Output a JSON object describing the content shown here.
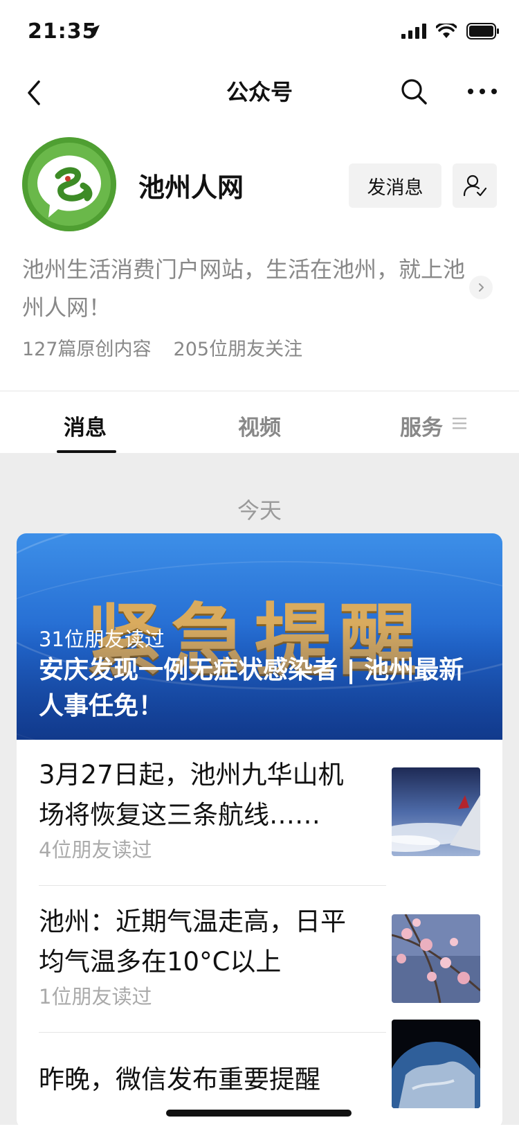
{
  "status_bar": {
    "time": "21:35"
  },
  "nav": {
    "title": "公众号"
  },
  "profile": {
    "name": "池州人网",
    "message_button": "发消息",
    "description": "池州生活消费门户网站，生活在池州，就上池州人网！",
    "original_count": "127篇原创内容",
    "followers": "205位朋友关注"
  },
  "tabs": [
    {
      "label": "消息"
    },
    {
      "label": "视频"
    },
    {
      "label": "服务"
    }
  ],
  "feed": {
    "date_label": "今天",
    "banner": {
      "image_text": "紧急提醒",
      "reads": "31位朋友读过",
      "title": "安庆发现一例无症状感染者 | 池州最新人事任免！"
    },
    "items": [
      {
        "title": "3月27日起，池州九华山机场将恢复这三条航线……",
        "reads": "4位朋友读过",
        "thumb": "airplane-wing"
      },
      {
        "title": "池州：近期气温走高，日平均气温多在10°C以上",
        "reads": "1位朋友读过",
        "thumb": "plum-blossom"
      },
      {
        "title": "昨晚，微信发布重要提醒",
        "reads": "",
        "thumb": "earth"
      }
    ]
  },
  "colors": {
    "accent_text": "#111111",
    "secondary_text": "#888888",
    "feed_bg": "#ededed",
    "banner_blue": "#2268cf",
    "banner_gold": "#d9ab5e",
    "logo_green": "#5aa93a"
  }
}
